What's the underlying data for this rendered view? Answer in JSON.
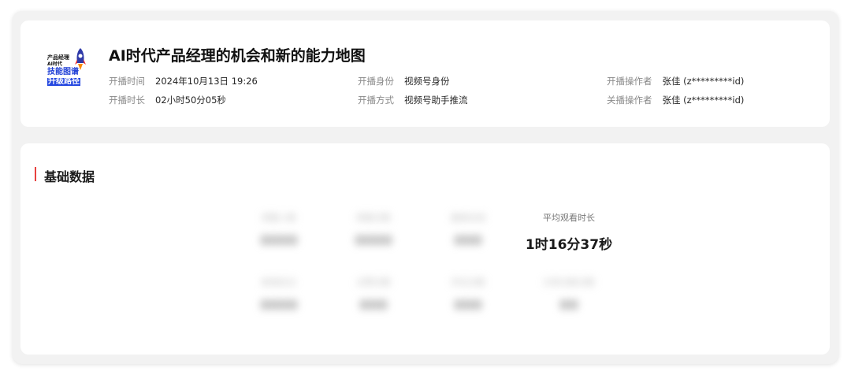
{
  "live": {
    "cover": {
      "line1": "产品经理",
      "line2": "AI时代",
      "line3": "技能图谱",
      "line4": "升级路径"
    },
    "title": "AI时代产品经理的机会和新的能力地图",
    "meta": {
      "start_time": {
        "label": "开播时间",
        "value": "2024年10月13日 19:26"
      },
      "duration": {
        "label": "开播时长",
        "value": "02小时50分05秒"
      },
      "identity": {
        "label": "开播身份",
        "value": "视频号身份"
      },
      "method": {
        "label": "开播方式",
        "value": "视频号助手推流"
      },
      "start_operator": {
        "label": "开播操作者",
        "value": "张佳 (z*********id)"
      },
      "end_operator": {
        "label": "关播操作者",
        "value": "张佳 (z*********id)"
      }
    }
  },
  "basic_data": {
    "title": "基础数据",
    "metrics": [
      {
        "label": "观看人数",
        "value": "0000",
        "blurred": true
      },
      {
        "label": "观看次数",
        "value": "0000",
        "blurred": true
      },
      {
        "label": "最高在线",
        "value": "000",
        "blurred": true
      },
      {
        "label": "平均观看时长",
        "value": "1时16分37秒",
        "blurred": false
      },
      {
        "label": "新增关注",
        "value": "0000",
        "blurred": true
      },
      {
        "label": "点赞次数",
        "value": "000",
        "blurred": true
      },
      {
        "label": "评论次数",
        "value": "000",
        "blurred": true
      },
      {
        "label": "分享次数次数",
        "value": "00",
        "blurred": true
      }
    ]
  },
  "colors": {
    "accent_bar": "#e8413f",
    "cover_blue": "#2447e0"
  }
}
